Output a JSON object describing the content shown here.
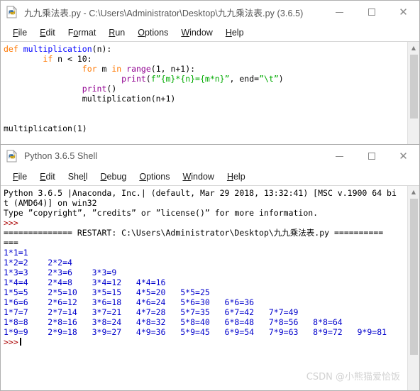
{
  "editor_window": {
    "icon": "python-file-icon",
    "title": "九九乘法表.py - C:\\Users\\Administrator\\Desktop\\九九乘法表.py (3.6.5)",
    "buttons": {
      "minimize": "minimize-icon",
      "maximize": "maximize-icon",
      "close": "close-icon"
    },
    "menu": [
      {
        "label": "File",
        "accel": "F"
      },
      {
        "label": "Edit",
        "accel": "E"
      },
      {
        "label": "Format",
        "accel": "o"
      },
      {
        "label": "Run",
        "accel": "R"
      },
      {
        "label": "Options",
        "accel": "O"
      },
      {
        "label": "Window",
        "accel": "W"
      },
      {
        "label": "Help",
        "accel": "H"
      }
    ],
    "code_lines": [
      [
        {
          "t": "def ",
          "c": "kw"
        },
        {
          "t": "multiplication",
          "c": "defname"
        },
        {
          "t": "(n):",
          "c": "plain"
        }
      ],
      [
        {
          "t": "        ",
          "c": "plain"
        },
        {
          "t": "if",
          "c": "kw"
        },
        {
          "t": " n < 10:",
          "c": "plain"
        }
      ],
      [
        {
          "t": "                ",
          "c": "plain"
        },
        {
          "t": "for",
          "c": "kw"
        },
        {
          "t": " m ",
          "c": "plain"
        },
        {
          "t": "in",
          "c": "kw"
        },
        {
          "t": " ",
          "c": "plain"
        },
        {
          "t": "range",
          "c": "builtin"
        },
        {
          "t": "(1, n+1):",
          "c": "plain"
        }
      ],
      [
        {
          "t": "                        ",
          "c": "plain"
        },
        {
          "t": "print",
          "c": "builtin"
        },
        {
          "t": "(",
          "c": "plain"
        },
        {
          "t": "f”{m}*{n}={m*n}”",
          "c": "str"
        },
        {
          "t": ", end=",
          "c": "plain"
        },
        {
          "t": "”\\t”",
          "c": "str"
        },
        {
          "t": ")",
          "c": "plain"
        }
      ],
      [
        {
          "t": "                ",
          "c": "plain"
        },
        {
          "t": "print",
          "c": "builtin"
        },
        {
          "t": "()",
          "c": "plain"
        }
      ],
      [
        {
          "t": "                ",
          "c": "plain"
        },
        {
          "t": "multiplication(n+1)",
          "c": "plain"
        }
      ],
      [
        {
          "t": "",
          "c": "plain"
        }
      ],
      [
        {
          "t": "",
          "c": "plain"
        }
      ],
      [
        {
          "t": "multiplication(1)",
          "c": "plain"
        }
      ]
    ],
    "scrollbar": {
      "up_arrow": "chevron-up-icon"
    }
  },
  "shell_window": {
    "icon": "python-shell-icon",
    "title": "Python 3.6.5 Shell",
    "buttons": {
      "minimize": "minimize-icon",
      "maximize": "maximize-icon",
      "close": "close-icon"
    },
    "menu": [
      {
        "label": "File",
        "accel": "F"
      },
      {
        "label": "Edit",
        "accel": "E"
      },
      {
        "label": "Shell",
        "accel": "l"
      },
      {
        "label": "Debug",
        "accel": "D"
      },
      {
        "label": "Options",
        "accel": "O"
      },
      {
        "label": "Window",
        "accel": "W"
      },
      {
        "label": "Help",
        "accel": "H"
      }
    ],
    "output_lines": [
      [
        {
          "t": "Python 3.6.5 |Anaconda, Inc.| (default, Mar 29 2018, 13:32:41) [MSC v.1900 64 bi",
          "c": "plain"
        }
      ],
      [
        {
          "t": "t (AMD64)] on win32",
          "c": "plain"
        }
      ],
      [
        {
          "t": "Type ”copyright”, ”credits” or ”license()” for more information.",
          "c": "plain"
        }
      ],
      [
        {
          "t": ">>>",
          "c": "prompt"
        }
      ],
      [
        {
          "t": "============== RESTART: C:\\Users\\Administrator\\Desktop\\九九乘法表.py ==========",
          "c": "plain"
        }
      ],
      [
        {
          "t": "===",
          "c": "plain"
        }
      ],
      [
        {
          "t": "1*1=1",
          "c": "out"
        }
      ],
      [
        {
          "t": "1*2=2    2*2=4",
          "c": "out"
        }
      ],
      [
        {
          "t": "1*3=3    2*3=6    3*3=9",
          "c": "out"
        }
      ],
      [
        {
          "t": "1*4=4    2*4=8    3*4=12   4*4=16",
          "c": "out"
        }
      ],
      [
        {
          "t": "1*5=5    2*5=10   3*5=15   4*5=20   5*5=25",
          "c": "out"
        }
      ],
      [
        {
          "t": "1*6=6    2*6=12   3*6=18   4*6=24   5*6=30   6*6=36",
          "c": "out"
        }
      ],
      [
        {
          "t": "1*7=7    2*7=14   3*7=21   4*7=28   5*7=35   6*7=42   7*7=49",
          "c": "out"
        }
      ],
      [
        {
          "t": "1*8=8    2*8=16   3*8=24   4*8=32   5*8=40   6*8=48   7*8=56   8*8=64",
          "c": "out"
        }
      ],
      [
        {
          "t": "1*9=9    2*9=18   3*9=27   4*9=36   5*9=45   6*9=54   7*9=63   8*9=72   9*9=81",
          "c": "out"
        }
      ]
    ],
    "final_prompt": ">>>",
    "scrollbar": {
      "up_arrow": "chevron-up-icon"
    }
  },
  "watermark": "CSDN @小熊猫爱恰饭",
  "colors": {
    "keyword": "#ff7700",
    "function_name": "#0000ff",
    "builtin": "#900090",
    "string": "#00aa00",
    "stdout": "#0000cc",
    "prompt": "#aa0000",
    "window_border": "#b0b0b0",
    "title_text": "#555555",
    "watermark": "#d2d2d2"
  }
}
